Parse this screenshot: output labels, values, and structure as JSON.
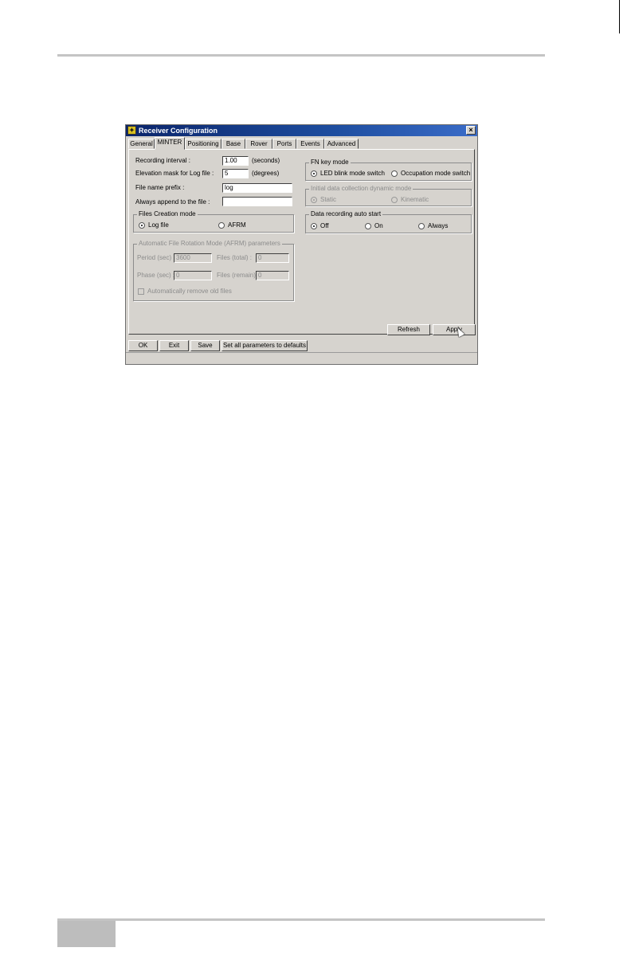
{
  "window": {
    "title": "Receiver Configuration",
    "close_glyph": "×"
  },
  "tabs": [
    {
      "label": "General"
    },
    {
      "label": "MINTER"
    },
    {
      "label": "Positioning"
    },
    {
      "label": "Base"
    },
    {
      "label": "Rover"
    },
    {
      "label": "Ports"
    },
    {
      "label": "Events"
    },
    {
      "label": "Advanced"
    }
  ],
  "active_tab": "MINTER",
  "recording": {
    "interval_label": "Recording interval :",
    "interval_value": "1.00",
    "interval_unit": "(seconds)",
    "elevation_label": "Elevation mask for Log file :",
    "elevation_value": "5",
    "elevation_unit": "(degrees)",
    "prefix_label": "File name prefix :",
    "prefix_value": "log",
    "append_label": "Always append to the file :",
    "append_value": ""
  },
  "files_creation": {
    "title": "Files Creation mode",
    "options": [
      {
        "label": "Log file",
        "selected": true
      },
      {
        "label": "AFRM",
        "selected": false
      }
    ]
  },
  "afrm": {
    "title": "Automatic File Rotation Mode (AFRM) parameters",
    "period_label": "Period (sec) :",
    "period_value": "3600",
    "files_total_label": "Files (total) :",
    "files_total_value": "0",
    "phase_label": "Phase (sec) :",
    "phase_value": "0",
    "files_remain_label": "Files (remain) :",
    "files_remain_value": "0",
    "auto_remove_label": "Automatically remove old files",
    "auto_remove_checked": false
  },
  "fn_key": {
    "title": "FN key mode",
    "options": [
      {
        "label": "LED blink mode switch",
        "selected": true
      },
      {
        "label": "Occupation mode switch",
        "selected": false
      }
    ]
  },
  "dynamic_mode": {
    "title": "Initial data collection dynamic mode",
    "options": [
      {
        "label": "Static",
        "selected": true
      },
      {
        "label": "Kinematic",
        "selected": false
      }
    ]
  },
  "auto_start": {
    "title": "Data recording auto start",
    "options": [
      {
        "label": "Off",
        "selected": true
      },
      {
        "label": "On",
        "selected": false
      },
      {
        "label": "Always",
        "selected": false
      }
    ]
  },
  "panel_buttons": {
    "refresh": "Refresh",
    "apply": "Apply"
  },
  "footer_buttons": {
    "ok": "OK",
    "exit": "Exit",
    "save": "Save",
    "defaults": "Set all parameters to defaults"
  },
  "colors": {
    "titlebar": "#0a246a",
    "dialog_bg": "#d6d3ce",
    "page_rule": "#c4c4c4"
  }
}
